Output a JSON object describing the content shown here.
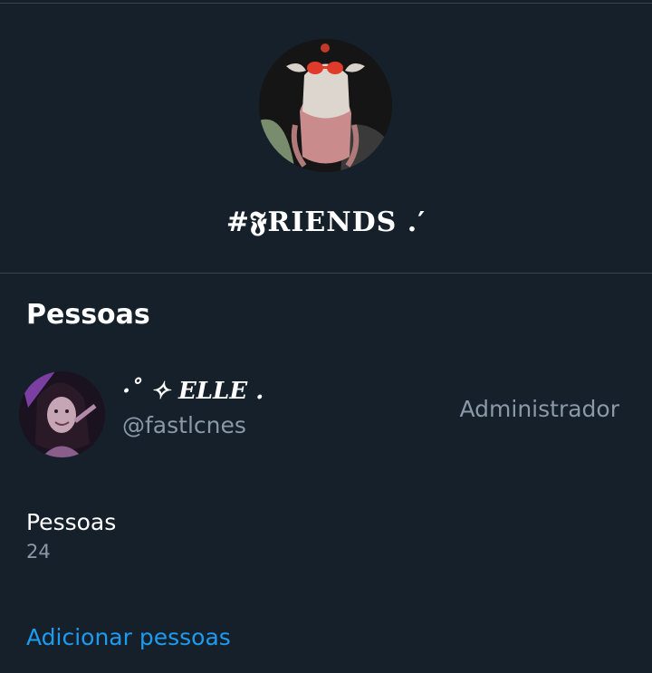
{
  "group": {
    "name": "#𝕱RIENDS .′",
    "avatar_icon": "group-photo"
  },
  "people_section": {
    "title": "Pessoas",
    "members": [
      {
        "display_name": "·˚ ✧ 𝑬𝑳𝑳𝑬 .",
        "handle": "@fastlcnes",
        "role": "Administrador",
        "avatar_icon": "user-avatar"
      }
    ],
    "count_label": "Pessoas",
    "count_value": "24",
    "add_link": "Adicionar pessoas"
  },
  "colors": {
    "background": "#15202b",
    "divider": "#38444d",
    "secondary_text": "#8b98a5",
    "link": "#1d9bf0"
  }
}
